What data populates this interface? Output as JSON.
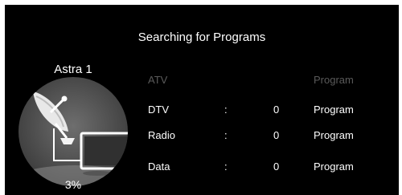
{
  "title": "Searching for Programs",
  "satellite": {
    "name": "Astra 1",
    "progress_text": "3%",
    "progress_percent": 3,
    "illustration_icon": "satellite-dish-tv-icon"
  },
  "rows": [
    {
      "name": "ATV",
      "colon": "",
      "count": "",
      "unit": "Program",
      "active": false
    },
    {
      "name": "DTV",
      "colon": ":",
      "count": "0",
      "unit": "Program",
      "active": true
    },
    {
      "name": "Radio",
      "colon": ":",
      "count": "0",
      "unit": "Program",
      "active": true
    },
    {
      "name": "Data",
      "colon": ":",
      "count": "0",
      "unit": "Program",
      "active": true
    }
  ],
  "colors": {
    "background": "#000000",
    "text": "#ffffff",
    "dimmed_text": "#5a5a5a"
  }
}
